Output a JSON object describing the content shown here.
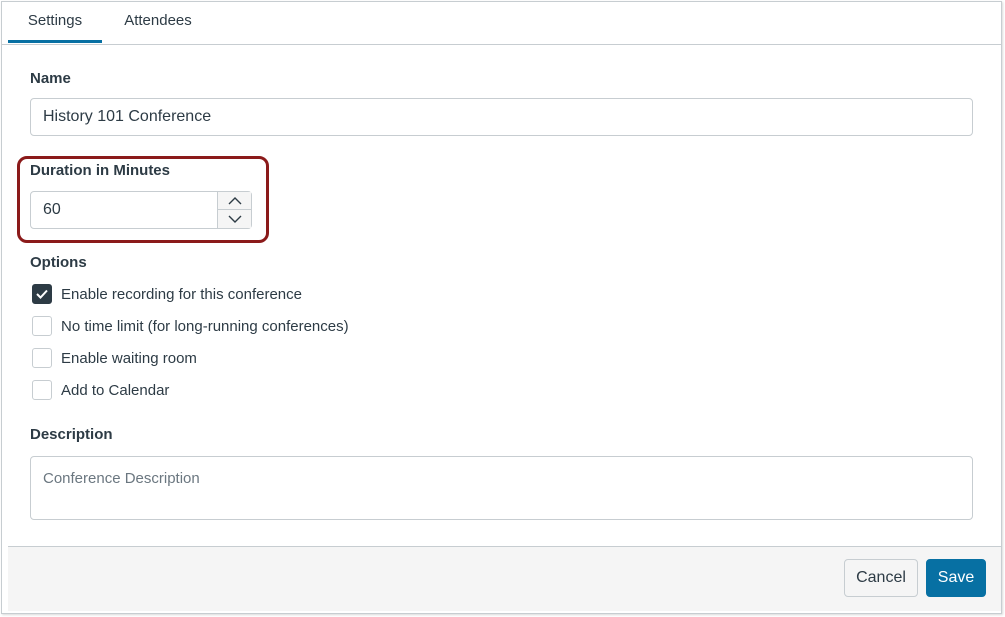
{
  "tabs": [
    {
      "label": "Settings",
      "active": true
    },
    {
      "label": "Attendees",
      "active": false
    }
  ],
  "form": {
    "name_label": "Name",
    "name_value": "History 101 Conference",
    "duration_label": "Duration in Minutes",
    "duration_value": "60",
    "options_label": "Options",
    "options": [
      {
        "label": "Enable recording for this conference",
        "checked": true
      },
      {
        "label": "No time limit (for long-running conferences)",
        "checked": false
      },
      {
        "label": "Enable waiting room",
        "checked": false
      },
      {
        "label": "Add to Calendar",
        "checked": false
      }
    ],
    "description_label": "Description",
    "description_placeholder": "Conference Description"
  },
  "footer": {
    "cancel_label": "Cancel",
    "save_label": "Save"
  },
  "colors": {
    "accent": "#0770a3",
    "highlight": "#8b1a1a",
    "text": "#2d3b45",
    "border": "#c7cdd1"
  },
  "icons": {
    "stepper_up": "chevron-up-icon",
    "stepper_down": "chevron-down-icon",
    "checkmark": "checkmark-icon"
  }
}
